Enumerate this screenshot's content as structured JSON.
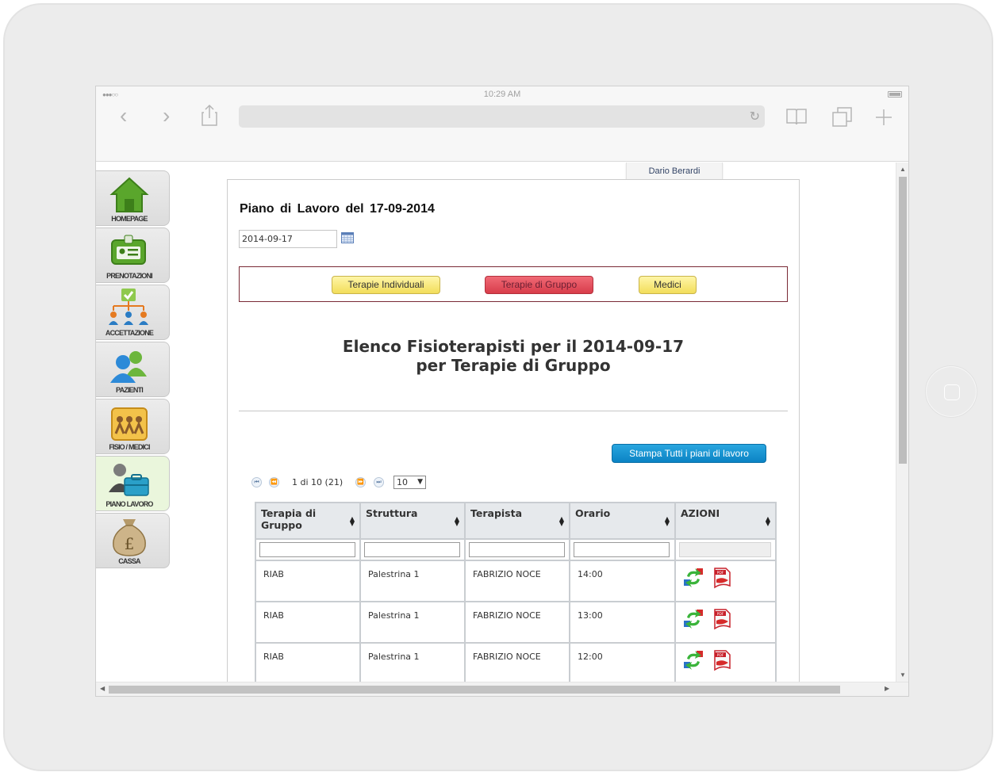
{
  "status_bar": {
    "time": "10:29 AM"
  },
  "user_tab": {
    "name": "Dario Berardi"
  },
  "sidebar": {
    "items": [
      {
        "label": "HOMEPAGE"
      },
      {
        "label": "PRENOTAZIONI"
      },
      {
        "label": "ACCETTAZIONE"
      },
      {
        "label": "PAZIENTI"
      },
      {
        "label": "FISIO / MEDICI"
      },
      {
        "label": "PIANO LAVORO",
        "active": true
      },
      {
        "label": "CASSA"
      }
    ]
  },
  "main": {
    "title": "Piano di Lavoro del 17-09-2014",
    "date_value": "2014-09-17",
    "tabs": [
      {
        "label": "Terapie Individuali"
      },
      {
        "label": "Terapie di Gruppo",
        "active": true
      },
      {
        "label": "Medici"
      }
    ],
    "heading_line1": "Elenco Fisioterapisti per il 2014-09-17",
    "heading_line2": "per Terapie di Gruppo",
    "print_button": "Stampa Tutti i piani di lavoro",
    "pager": {
      "text": "1 di 10 (21)",
      "page_size": "10"
    },
    "table": {
      "columns": [
        "Terapia di Gruppo",
        "Struttura",
        "Terapista",
        "Orario",
        "AZIONI"
      ],
      "rows": [
        {
          "terapia": "RIAB",
          "struttura": "Palestrina 1",
          "terapista": "FABRIZIO NOCE",
          "orario": "14:00"
        },
        {
          "terapia": "RIAB",
          "struttura": "Palestrina 1",
          "terapista": "FABRIZIO NOCE",
          "orario": "13:00"
        },
        {
          "terapia": "RIAB",
          "struttura": "Palestrina 1",
          "terapista": "FABRIZIO NOCE",
          "orario": "12:00"
        }
      ],
      "action_icon_label": "PDF"
    }
  },
  "colors": {
    "accent_red": "#d83c4a",
    "accent_yellow": "#f2dd5a",
    "accent_blue": "#0b83c4",
    "tabs_border": "#7a2a35"
  }
}
